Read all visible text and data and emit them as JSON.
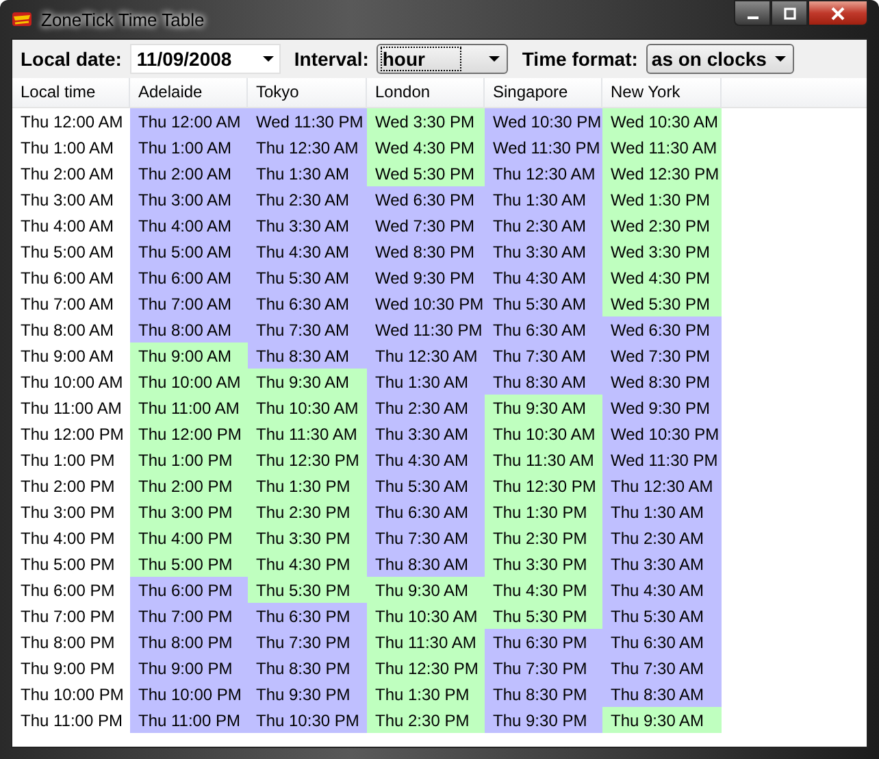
{
  "window": {
    "title": "ZoneTick Time Table"
  },
  "toolbar": [
    {
      "label": "Local date:",
      "value": "11/09/2008",
      "kind": "field"
    },
    {
      "label": "Interval:",
      "value": "hour",
      "kind": "select"
    },
    {
      "label": "Time format:",
      "value": "as on clocks",
      "kind": "select"
    }
  ],
  "table": {
    "columns": [
      "Local time",
      "Adelaide",
      "Tokyo",
      "London",
      "Singapore",
      "New York"
    ],
    "rows": [
      {
        "cells": [
          {
            "text": "Thu 12:00 AM"
          },
          {
            "text": "Thu 12:00 AM",
            "work": false
          },
          {
            "text": "Wed 11:30 PM",
            "work": false
          },
          {
            "text": "Wed 3:30 PM",
            "work": true
          },
          {
            "text": "Wed 10:30 PM",
            "work": false
          },
          {
            "text": "Wed 10:30 AM",
            "work": true
          }
        ]
      },
      {
        "cells": [
          {
            "text": "Thu 1:00 AM"
          },
          {
            "text": "Thu 1:00 AM",
            "work": false
          },
          {
            "text": "Thu 12:30 AM",
            "work": false
          },
          {
            "text": "Wed 4:30 PM",
            "work": true
          },
          {
            "text": "Wed 11:30 PM",
            "work": false
          },
          {
            "text": "Wed 11:30 AM",
            "work": true
          }
        ]
      },
      {
        "cells": [
          {
            "text": "Thu 2:00 AM"
          },
          {
            "text": "Thu 2:00 AM",
            "work": false
          },
          {
            "text": "Thu 1:30 AM",
            "work": false
          },
          {
            "text": "Wed 5:30 PM",
            "work": true
          },
          {
            "text": "Thu 12:30 AM",
            "work": false
          },
          {
            "text": "Wed 12:30 PM",
            "work": true
          }
        ]
      },
      {
        "cells": [
          {
            "text": "Thu 3:00 AM"
          },
          {
            "text": "Thu 3:00 AM",
            "work": false
          },
          {
            "text": "Thu 2:30 AM",
            "work": false
          },
          {
            "text": "Wed 6:30 PM",
            "work": false
          },
          {
            "text": "Thu 1:30 AM",
            "work": false
          },
          {
            "text": "Wed 1:30 PM",
            "work": true
          }
        ]
      },
      {
        "cells": [
          {
            "text": "Thu 4:00 AM"
          },
          {
            "text": "Thu 4:00 AM",
            "work": false
          },
          {
            "text": "Thu 3:30 AM",
            "work": false
          },
          {
            "text": "Wed 7:30 PM",
            "work": false
          },
          {
            "text": "Thu 2:30 AM",
            "work": false
          },
          {
            "text": "Wed 2:30 PM",
            "work": true
          }
        ]
      },
      {
        "cells": [
          {
            "text": "Thu 5:00 AM"
          },
          {
            "text": "Thu 5:00 AM",
            "work": false
          },
          {
            "text": "Thu 4:30 AM",
            "work": false
          },
          {
            "text": "Wed 8:30 PM",
            "work": false
          },
          {
            "text": "Thu 3:30 AM",
            "work": false
          },
          {
            "text": "Wed 3:30 PM",
            "work": true
          }
        ]
      },
      {
        "cells": [
          {
            "text": "Thu 6:00 AM"
          },
          {
            "text": "Thu 6:00 AM",
            "work": false
          },
          {
            "text": "Thu 5:30 AM",
            "work": false
          },
          {
            "text": "Wed 9:30 PM",
            "work": false
          },
          {
            "text": "Thu 4:30 AM",
            "work": false
          },
          {
            "text": "Wed 4:30 PM",
            "work": true
          }
        ]
      },
      {
        "cells": [
          {
            "text": "Thu 7:00 AM"
          },
          {
            "text": "Thu 7:00 AM",
            "work": false
          },
          {
            "text": "Thu 6:30 AM",
            "work": false
          },
          {
            "text": "Wed 10:30 PM",
            "work": false
          },
          {
            "text": "Thu 5:30 AM",
            "work": false
          },
          {
            "text": "Wed 5:30 PM",
            "work": true
          }
        ]
      },
      {
        "cells": [
          {
            "text": "Thu 8:00 AM"
          },
          {
            "text": "Thu 8:00 AM",
            "work": false
          },
          {
            "text": "Thu 7:30 AM",
            "work": false
          },
          {
            "text": "Wed 11:30 PM",
            "work": false
          },
          {
            "text": "Thu 6:30 AM",
            "work": false
          },
          {
            "text": "Wed 6:30 PM",
            "work": false
          }
        ]
      },
      {
        "cells": [
          {
            "text": "Thu 9:00 AM"
          },
          {
            "text": "Thu 9:00 AM",
            "work": true
          },
          {
            "text": "Thu 8:30 AM",
            "work": false
          },
          {
            "text": "Thu 12:30 AM",
            "work": false
          },
          {
            "text": "Thu 7:30 AM",
            "work": false
          },
          {
            "text": "Wed 7:30 PM",
            "work": false
          }
        ]
      },
      {
        "cells": [
          {
            "text": "Thu 10:00 AM"
          },
          {
            "text": "Thu 10:00 AM",
            "work": true
          },
          {
            "text": "Thu 9:30 AM",
            "work": true
          },
          {
            "text": "Thu 1:30 AM",
            "work": false
          },
          {
            "text": "Thu 8:30 AM",
            "work": false
          },
          {
            "text": "Wed 8:30 PM",
            "work": false
          }
        ]
      },
      {
        "cells": [
          {
            "text": "Thu 11:00 AM"
          },
          {
            "text": "Thu 11:00 AM",
            "work": true
          },
          {
            "text": "Thu 10:30 AM",
            "work": true
          },
          {
            "text": "Thu 2:30 AM",
            "work": false
          },
          {
            "text": "Thu 9:30 AM",
            "work": true
          },
          {
            "text": "Wed 9:30 PM",
            "work": false
          }
        ]
      },
      {
        "cells": [
          {
            "text": "Thu 12:00 PM"
          },
          {
            "text": "Thu 12:00 PM",
            "work": true
          },
          {
            "text": "Thu 11:30 AM",
            "work": true
          },
          {
            "text": "Thu 3:30 AM",
            "work": false
          },
          {
            "text": "Thu 10:30 AM",
            "work": true
          },
          {
            "text": "Wed 10:30 PM",
            "work": false
          }
        ]
      },
      {
        "cells": [
          {
            "text": "Thu 1:00 PM"
          },
          {
            "text": "Thu 1:00 PM",
            "work": true
          },
          {
            "text": "Thu 12:30 PM",
            "work": true
          },
          {
            "text": "Thu 4:30 AM",
            "work": false
          },
          {
            "text": "Thu 11:30 AM",
            "work": true
          },
          {
            "text": "Wed 11:30 PM",
            "work": false
          }
        ]
      },
      {
        "cells": [
          {
            "text": "Thu 2:00 PM"
          },
          {
            "text": "Thu 2:00 PM",
            "work": true
          },
          {
            "text": "Thu 1:30 PM",
            "work": true
          },
          {
            "text": "Thu 5:30 AM",
            "work": false
          },
          {
            "text": "Thu 12:30 PM",
            "work": true
          },
          {
            "text": "Thu 12:30 AM",
            "work": false
          }
        ]
      },
      {
        "cells": [
          {
            "text": "Thu 3:00 PM"
          },
          {
            "text": "Thu 3:00 PM",
            "work": true
          },
          {
            "text": "Thu 2:30 PM",
            "work": true
          },
          {
            "text": "Thu 6:30 AM",
            "work": false
          },
          {
            "text": "Thu 1:30 PM",
            "work": true
          },
          {
            "text": "Thu 1:30 AM",
            "work": false
          }
        ]
      },
      {
        "cells": [
          {
            "text": "Thu 4:00 PM"
          },
          {
            "text": "Thu 4:00 PM",
            "work": true
          },
          {
            "text": "Thu 3:30 PM",
            "work": true
          },
          {
            "text": "Thu 7:30 AM",
            "work": false
          },
          {
            "text": "Thu 2:30 PM",
            "work": true
          },
          {
            "text": "Thu 2:30 AM",
            "work": false
          }
        ]
      },
      {
        "cells": [
          {
            "text": "Thu 5:00 PM"
          },
          {
            "text": "Thu 5:00 PM",
            "work": true
          },
          {
            "text": "Thu 4:30 PM",
            "work": true
          },
          {
            "text": "Thu 8:30 AM",
            "work": false
          },
          {
            "text": "Thu 3:30 PM",
            "work": true
          },
          {
            "text": "Thu 3:30 AM",
            "work": false
          }
        ]
      },
      {
        "cells": [
          {
            "text": "Thu 6:00 PM"
          },
          {
            "text": "Thu 6:00 PM",
            "work": false
          },
          {
            "text": "Thu 5:30 PM",
            "work": true
          },
          {
            "text": "Thu 9:30 AM",
            "work": true
          },
          {
            "text": "Thu 4:30 PM",
            "work": true
          },
          {
            "text": "Thu 4:30 AM",
            "work": false
          }
        ]
      },
      {
        "cells": [
          {
            "text": "Thu 7:00 PM"
          },
          {
            "text": "Thu 7:00 PM",
            "work": false
          },
          {
            "text": "Thu 6:30 PM",
            "work": false
          },
          {
            "text": "Thu 10:30 AM",
            "work": true
          },
          {
            "text": "Thu 5:30 PM",
            "work": true
          },
          {
            "text": "Thu 5:30 AM",
            "work": false
          }
        ]
      },
      {
        "cells": [
          {
            "text": "Thu 8:00 PM"
          },
          {
            "text": "Thu 8:00 PM",
            "work": false
          },
          {
            "text": "Thu 7:30 PM",
            "work": false
          },
          {
            "text": "Thu 11:30 AM",
            "work": true
          },
          {
            "text": "Thu 6:30 PM",
            "work": false
          },
          {
            "text": "Thu 6:30 AM",
            "work": false
          }
        ]
      },
      {
        "cells": [
          {
            "text": "Thu 9:00 PM"
          },
          {
            "text": "Thu 9:00 PM",
            "work": false
          },
          {
            "text": "Thu 8:30 PM",
            "work": false
          },
          {
            "text": "Thu 12:30 PM",
            "work": true
          },
          {
            "text": "Thu 7:30 PM",
            "work": false
          },
          {
            "text": "Thu 7:30 AM",
            "work": false
          }
        ]
      },
      {
        "cells": [
          {
            "text": "Thu 10:00 PM"
          },
          {
            "text": "Thu 10:00 PM",
            "work": false
          },
          {
            "text": "Thu 9:30 PM",
            "work": false
          },
          {
            "text": "Thu 1:30 PM",
            "work": true
          },
          {
            "text": "Thu 8:30 PM",
            "work": false
          },
          {
            "text": "Thu 8:30 AM",
            "work": false
          }
        ]
      },
      {
        "cells": [
          {
            "text": "Thu 11:00 PM"
          },
          {
            "text": "Thu 11:00 PM",
            "work": false
          },
          {
            "text": "Thu 10:30 PM",
            "work": false
          },
          {
            "text": "Thu 2:30 PM",
            "work": true
          },
          {
            "text": "Thu 9:30 PM",
            "work": false
          },
          {
            "text": "Thu 9:30 AM",
            "work": true
          }
        ]
      }
    ]
  }
}
